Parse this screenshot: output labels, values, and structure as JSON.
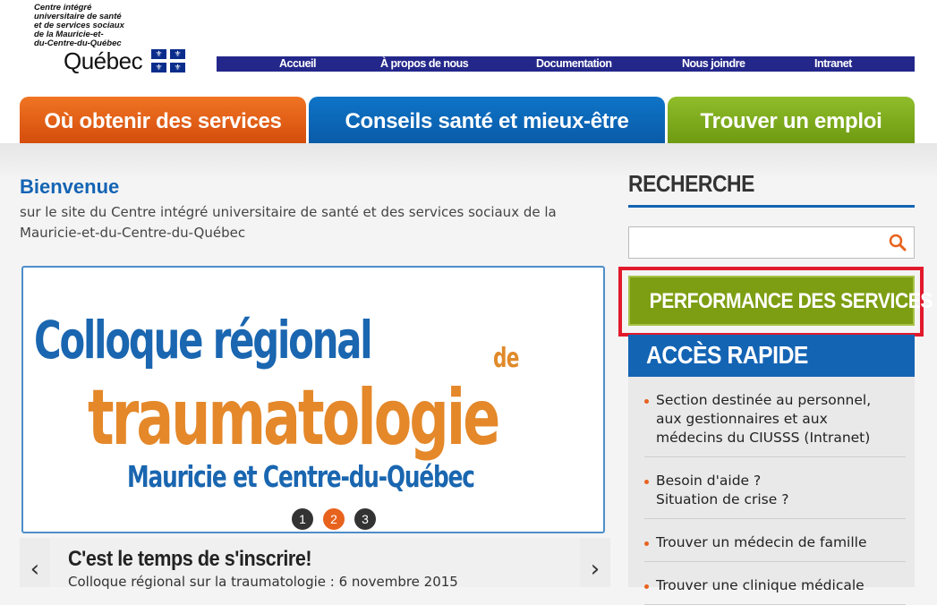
{
  "header": {
    "org_name_lines": [
      "Centre intégré",
      "universitaire de santé",
      "et de services sociaux",
      "de la Mauricie-et-",
      "du-Centre-du-Québec"
    ],
    "quebec_word": "Québec",
    "flag_symbol": "⚜"
  },
  "topnav": {
    "items": [
      {
        "label": "Accueil"
      },
      {
        "label": "À propos de nous"
      },
      {
        "label": "Documentation"
      },
      {
        "label": "Nous joindre"
      },
      {
        "label": "Intranet"
      }
    ]
  },
  "main_tabs": [
    {
      "label": "Où obtenir des services"
    },
    {
      "label": "Conseils santé et mieux-être"
    },
    {
      "label": "Trouver un emploi"
    }
  ],
  "welcome": {
    "title": "Bienvenue",
    "subtitle": "sur le site du Centre intégré universitaire de santé et des services sociaux de la Mauricie-et-du-Centre-du-Québec"
  },
  "slider": {
    "line1": "Colloque régional",
    "line1_suffix": "de",
    "line2": "traumatologie",
    "line3": "Mauricie et Centre-du-Québec",
    "dots": [
      "1",
      "2",
      "3"
    ],
    "active_dot": "2",
    "caption_title": "C'est le temps de s'inscrire!",
    "caption_sub": "Colloque régional sur la traumatologie : 6 novembre 2015",
    "prev_arrow": "‹",
    "next_arrow": "›"
  },
  "search": {
    "title": "RECHERCHE",
    "placeholder": ""
  },
  "performance_button": "PERFORMANCE DES SERVICES",
  "quick_access": {
    "title": "ACCÈS RAPIDE",
    "items": [
      {
        "lines": [
          "Section destinée au personnel,",
          "aux gestionnaires et aux",
          "médecins du CIUSSS (Intranet)"
        ]
      },
      {
        "lines": [
          "Besoin d'aide ?",
          "Situation de crise ?"
        ]
      },
      {
        "lines": [
          "Trouver un médecin de famille"
        ]
      },
      {
        "lines": [
          "Trouver une clinique médicale"
        ]
      }
    ]
  },
  "colors": {
    "brand_blue": "#1464b4",
    "nav_blue": "#24278a",
    "orange": "#e7621d",
    "green": "#7d9e12",
    "highlight_red": "#e11a2c"
  }
}
